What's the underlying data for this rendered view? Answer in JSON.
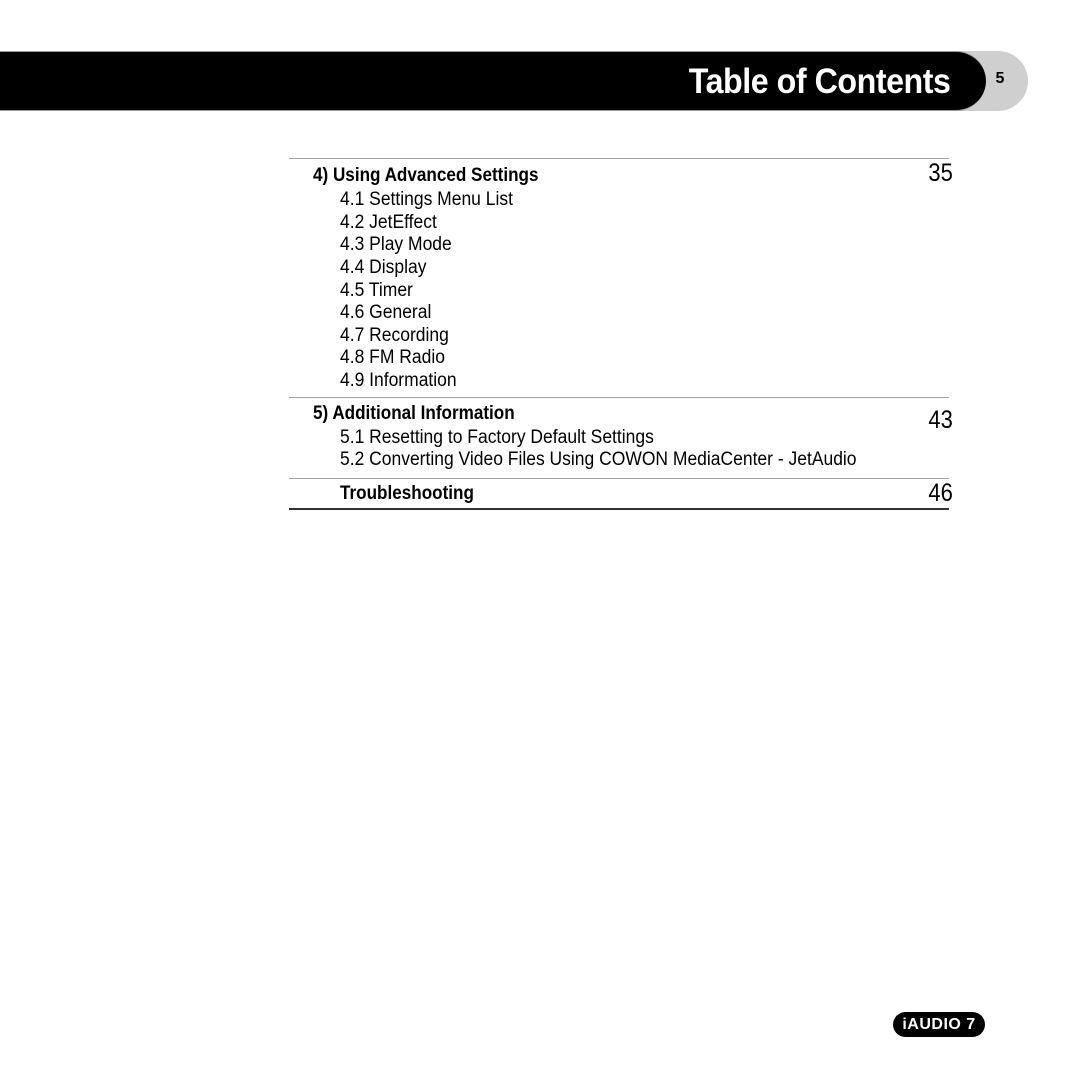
{
  "header": {
    "title": "Table of Contents",
    "page_number": "5"
  },
  "toc": {
    "sections": [
      {
        "title": "4) Using Advanced Settings",
        "page": "35",
        "items": [
          "4.1 Settings Menu List",
          "4.2 JetEffect",
          "4.3 Play Mode",
          "4.4 Display",
          "4.5 Timer",
          "4.6 General",
          "4.7 Recording",
          "4.8 FM Radio",
          "4.9 Information"
        ]
      },
      {
        "title": "5) Additional Information",
        "page": "43",
        "items": [
          "5.1 Resetting to Factory Default Settings",
          "5.2 Converting Video Files Using COWON MediaCenter - JetAudio"
        ]
      },
      {
        "title": "Troubleshooting",
        "page": "46",
        "items": []
      }
    ]
  },
  "footer": {
    "brand": "iAUDIO 7"
  }
}
